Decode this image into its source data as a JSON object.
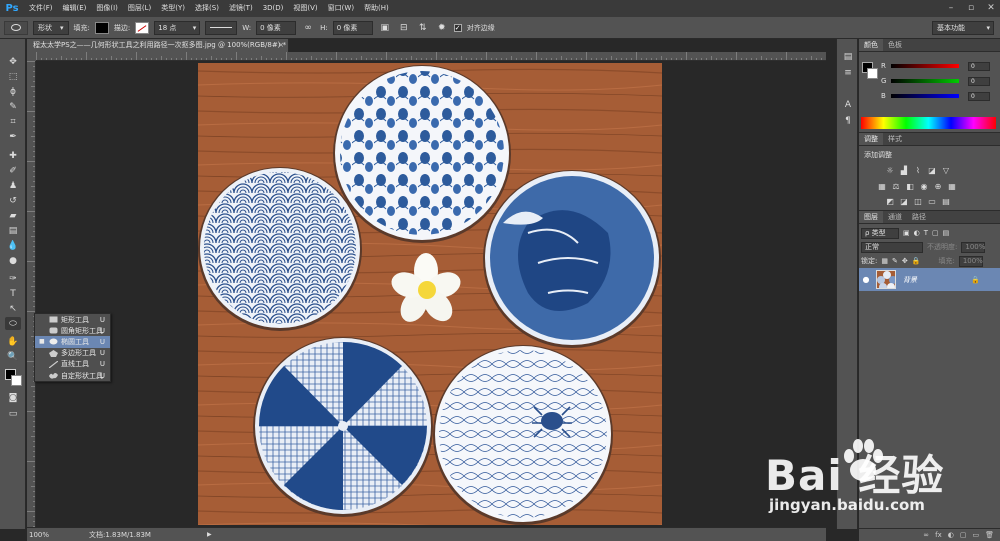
{
  "app": {
    "logo": "Ps"
  },
  "menu": [
    "文件(F)",
    "编辑(E)",
    "图像(I)",
    "图层(L)",
    "类型(Y)",
    "选择(S)",
    "滤镜(T)",
    "3D(D)",
    "视图(V)",
    "窗口(W)",
    "帮助(H)"
  ],
  "window_controls": {
    "minimize": "–",
    "restore": "▫",
    "close": "✕"
  },
  "options": {
    "mode": "形状",
    "fill_label": "填充:",
    "stroke_label": "描边:",
    "stroke_size": "18 点",
    "w_label": "W:",
    "w_value": "0 像素",
    "h_label": "H:",
    "h_value": "0 像素",
    "align_edges_label": "对齐边缘",
    "align_edges_checked": "✓",
    "workspace": "基本功能"
  },
  "document": {
    "tab_title": "程太太学PS之——几何形状工具之利用路径一次抠多图.jpg @ 100%(RGB/8#) *",
    "close": "×",
    "zoom": "100%",
    "doc_size": "文档:1.83M/1.83M",
    "status_arrow": "▶"
  },
  "shape_flyout": [
    {
      "label": "矩形工具",
      "key": "U",
      "active": false
    },
    {
      "label": "圆角矩形工具",
      "key": "U",
      "active": false
    },
    {
      "label": "椭圆工具",
      "key": "U",
      "active": true
    },
    {
      "label": "多边形工具",
      "key": "U",
      "active": false
    },
    {
      "label": "直线工具",
      "key": "U",
      "active": false
    },
    {
      "label": "自定形状工具",
      "key": "U",
      "active": false
    }
  ],
  "color_panel": {
    "tabs": [
      "颜色",
      "色板"
    ],
    "rows": [
      {
        "label": "R",
        "value": "0",
        "color": "#ff0000"
      },
      {
        "label": "G",
        "value": "0",
        "color": "#00c000"
      },
      {
        "label": "B",
        "value": "0",
        "color": "#0000ff"
      }
    ]
  },
  "adjust_panel": {
    "tabs": [
      "调整",
      "样式"
    ],
    "title": "添加调整"
  },
  "layers_panel": {
    "tabs": [
      "图层",
      "通道",
      "路径"
    ],
    "kind_filter": "ρ 类型",
    "blend_mode": "正常",
    "opacity_label": "不透明度:",
    "opacity_value": "100%",
    "lock_label": "锁定:",
    "fill_label": "填充:",
    "fill_value": "100%",
    "layer": {
      "name": "背景",
      "visible": "●",
      "lock": "🔒"
    },
    "bottom_icons": [
      "∞",
      "fx",
      "◐",
      "▢",
      "▭",
      "🗑"
    ]
  },
  "watermark": {
    "brand": "Bai  经验",
    "url": "jingyan.baidu.com"
  },
  "colors": {
    "wood": "#a65d36",
    "plate_blue": "#274e8c",
    "highlight": "#6b87b3"
  }
}
